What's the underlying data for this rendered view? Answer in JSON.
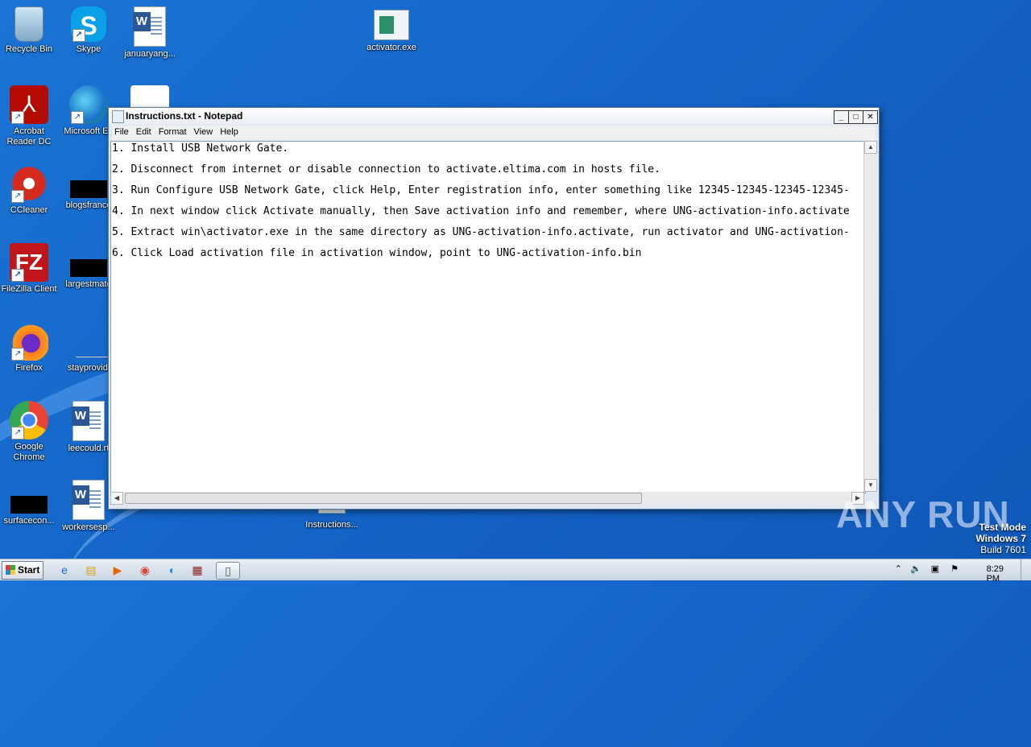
{
  "desktop": {
    "icons": [
      {
        "label": "Recycle Bin",
        "icon": "recycle-bin-icon"
      },
      {
        "label": "Skype",
        "icon": "skype-icon"
      },
      {
        "label": "januaryang...",
        "icon": "word-document-icon"
      },
      {
        "label": "activator.exe",
        "icon": "exe-icon"
      },
      {
        "label": "Acrobat Reader DC",
        "icon": "acrobat-icon"
      },
      {
        "label": "Microsoft Ed",
        "icon": "edge-icon"
      },
      {
        "label": "CCleaner",
        "icon": "ccleaner-icon"
      },
      {
        "label": "blogsfrance",
        "icon": "file-icon"
      },
      {
        "label": "FileZilla Client",
        "icon": "filezilla-icon"
      },
      {
        "label": "largestmato",
        "icon": "file-icon"
      },
      {
        "label": "Firefox",
        "icon": "firefox-icon"
      },
      {
        "label": "stayprovidi",
        "icon": "file-icon"
      },
      {
        "label": "Google Chrome",
        "icon": "chrome-icon"
      },
      {
        "label": "leecould.rt",
        "icon": "word-document-icon"
      },
      {
        "label": "surfacecon...",
        "icon": "file-icon"
      },
      {
        "label": "workersesp...",
        "icon": "word-document-icon"
      },
      {
        "label": "Instructions...",
        "icon": "text-file-icon"
      }
    ]
  },
  "notepad": {
    "title": "Instructions.txt - Notepad",
    "menu": [
      "File",
      "Edit",
      "Format",
      "View",
      "Help"
    ],
    "lines": [
      "1. Install USB Network Gate.",
      "2. Disconnect from internet or disable connection to activate.eltima.com in hosts file.",
      "3. Run Configure USB Network Gate, click Help, Enter registration info, enter something like 12345-12345-12345-12345-",
      "4. In next window click Activate manually, then Save activation info and remember, where UNG-activation-info.activate",
      "5. Extract win\\activator.exe in the same directory as UNG-activation-info.activate, run activator and UNG-activation-",
      "6. Click Load activation file in activation window, point to UNG-activation-info.bin"
    ]
  },
  "taskbar": {
    "start_label": "Start",
    "clock": "8:29 PM"
  },
  "watermark": {
    "brand": "ANY RUN",
    "mode_line1": "Test Mode",
    "mode_line2": "Windows 7",
    "mode_line3": "Build 7601"
  }
}
